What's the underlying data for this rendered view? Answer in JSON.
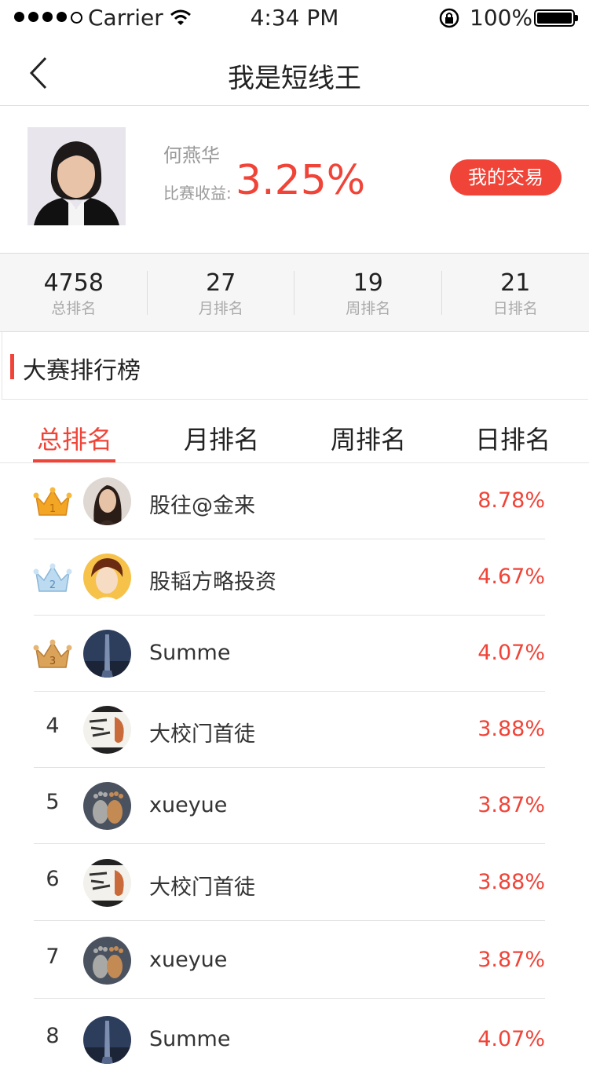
{
  "status_bar": {
    "carrier": "Carrier",
    "time": "4:34 PM",
    "battery": "100%",
    "signal_bars": 4
  },
  "nav": {
    "title": "我是短线王"
  },
  "profile": {
    "name": "何燕华",
    "return_label": "比赛收益:",
    "return_value": "3.25%",
    "trade_button": "我的交易"
  },
  "stats": [
    {
      "value": "4758",
      "label": "总排名"
    },
    {
      "value": "27",
      "label": "月排名"
    },
    {
      "value": "19",
      "label": "周排名"
    },
    {
      "value": "21",
      "label": "日排名"
    }
  ],
  "section": {
    "title": "大赛排行榜"
  },
  "tabs": [
    {
      "label": "总排名",
      "active": true
    },
    {
      "label": "月排名",
      "active": false
    },
    {
      "label": "周排名",
      "active": false
    },
    {
      "label": "日排名",
      "active": false
    }
  ],
  "rankings": [
    {
      "rank": "1",
      "name": "股往@金来",
      "value": "8.78%",
      "crown": "gold",
      "avatar": "woman-dark-hair"
    },
    {
      "rank": "2",
      "name": "股韬方略投资",
      "value": "4.67%",
      "crown": "silver",
      "avatar": "cartoon-man"
    },
    {
      "rank": "3",
      "name": "Summe",
      "value": "4.07%",
      "crown": "bronze",
      "avatar": "tower-night"
    },
    {
      "rank": "4",
      "name": "大校门首徒",
      "value": "3.88%",
      "crown": "",
      "avatar": "calligraphy"
    },
    {
      "rank": "5",
      "name": "xueyue",
      "value": "3.87%",
      "crown": "",
      "avatar": "stone-feet"
    },
    {
      "rank": "6",
      "name": "大校门首徒",
      "value": "3.88%",
      "crown": "",
      "avatar": "calligraphy"
    },
    {
      "rank": "7",
      "name": "xueyue",
      "value": "3.87%",
      "crown": "",
      "avatar": "stone-feet"
    },
    {
      "rank": "8",
      "name": "Summe",
      "value": "4.07%",
      "crown": "",
      "avatar": "tower-night"
    }
  ],
  "colors": {
    "accent": "#f04438",
    "gold": "#f2a623",
    "silver": "#9fc6e4",
    "bronze": "#d79a4a"
  }
}
